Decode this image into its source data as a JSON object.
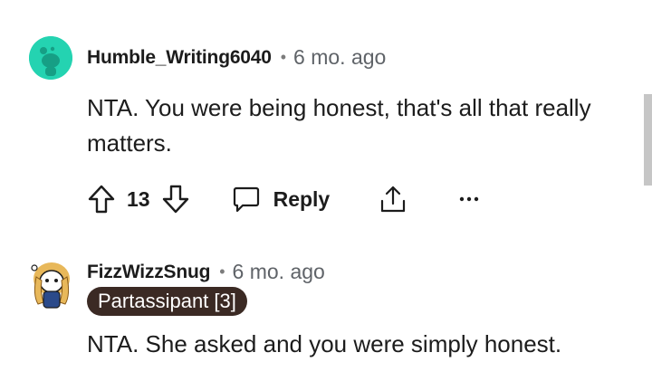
{
  "comments": [
    {
      "username": "Humble_Writing6040",
      "separator": "•",
      "time": "6 mo. ago",
      "text": "NTA. You were being honest, that's all that really matters.",
      "vote_count": "13",
      "reply_label": "Reply",
      "avatar_icon": "snoo-avatar-icon",
      "avatar_color": "#24d3b1"
    },
    {
      "username": "FizzWizzSnug",
      "separator": "•",
      "time": "6 mo. ago",
      "flair": "Partassipant [3]",
      "text": "NTA. She asked and you were simply honest.",
      "avatar_icon": "snoo-avatar-icon"
    }
  ],
  "icons": {
    "upvote": "upvote-icon",
    "downvote": "downvote-icon",
    "reply": "speech-bubble-icon",
    "share": "share-icon",
    "more": "more-options-icon"
  },
  "colors": {
    "flair_bg": "#3b2a24",
    "text": "#1c1c1c",
    "meta": "#5f6368"
  }
}
